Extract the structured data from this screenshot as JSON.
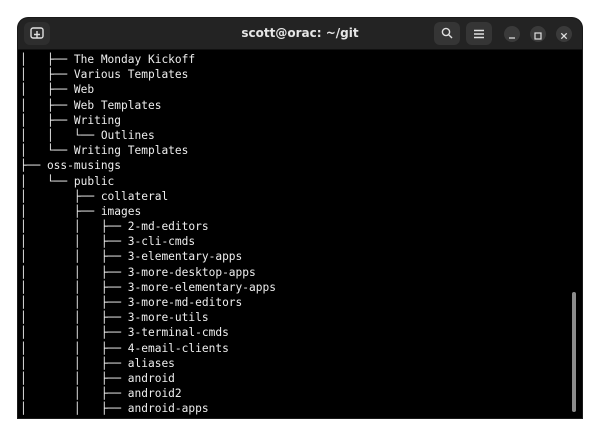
{
  "window": {
    "title": "scott@orac: ~/git"
  },
  "icons": {
    "new_tab": "new-tab-icon",
    "search": "search-icon",
    "menu": "hamburger-menu-icon",
    "minimize": "minimize-icon",
    "maximize": "maximize-icon",
    "close": "close-icon"
  },
  "colors": {
    "terminal_bg": "#000000",
    "terminal_fg": "#eeeeee",
    "titlebar_bg": "#232323"
  },
  "terminal": {
    "lines": [
      "│   ├── The Monday Kickoff",
      "│   ├── Various Templates",
      "│   ├── Web",
      "│   ├── Web Templates",
      "│   ├── Writing",
      "│   │   └── Outlines",
      "│   └── Writing Templates",
      "├── oss-musings",
      "│   └── public",
      "│       ├── collateral",
      "│       ├── images",
      "│       │   ├── 2-md-editors",
      "│       │   ├── 3-cli-cmds",
      "│       │   ├── 3-elementary-apps",
      "│       │   ├── 3-more-desktop-apps",
      "│       │   ├── 3-more-elementary-apps",
      "│       │   ├── 3-more-md-editors",
      "│       │   ├── 3-more-utils",
      "│       │   ├── 3-terminal-cmds",
      "│       │   ├── 4-email-clients",
      "│       │   ├── aliases",
      "│       │   ├── android",
      "│       │   ├── android2",
      "│       │   ├── android-apps"
    ]
  }
}
